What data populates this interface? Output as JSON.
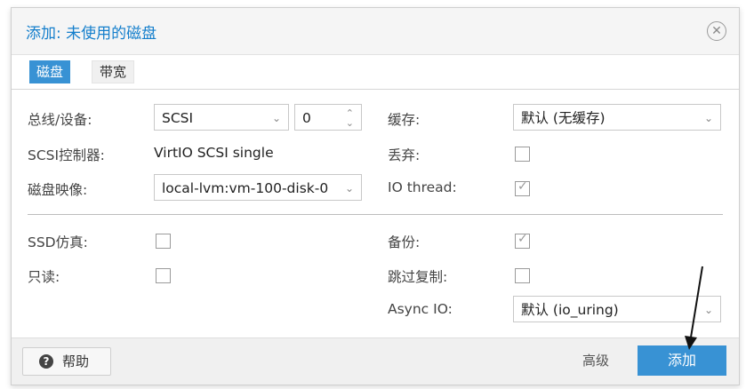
{
  "dialog": {
    "title": "添加: 未使用的磁盘",
    "close_symbol": "✕"
  },
  "tabs": [
    {
      "label": "磁盘",
      "active": true
    },
    {
      "label": "带宽",
      "active": false
    }
  ],
  "form": {
    "bus_device": {
      "label": "总线/设备:",
      "bus_value": "SCSI",
      "index_value": "0"
    },
    "cache": {
      "label": "缓存:",
      "value": "默认 (无缓存)"
    },
    "scsi_controller": {
      "label": "SCSI控制器:",
      "value": "VirtIO SCSI single"
    },
    "discard": {
      "label": "丢弃:",
      "checked": false
    },
    "disk_image": {
      "label": "磁盘映像:",
      "value": "local-lvm:vm-100-disk-0"
    },
    "io_thread": {
      "label": "IO thread:",
      "checked": true
    },
    "ssd_emulation": {
      "label": "SSD仿真:",
      "checked": false
    },
    "backup": {
      "label": "备份:",
      "checked": true
    },
    "read_only": {
      "label": "只读:",
      "checked": false
    },
    "skip_replication": {
      "label": "跳过复制:",
      "checked": false
    },
    "async_io": {
      "label": "Async IO:",
      "value": "默认 (io_uring)"
    }
  },
  "footer": {
    "help_label": "帮助",
    "advanced_label": "高级",
    "add_label": "添加"
  },
  "icons": {
    "help": "question-circle-icon",
    "close": "close-icon",
    "dropdown": "chevron-down-icon",
    "spinner": "spinner-arrows-icon",
    "check": "check-icon"
  },
  "colors": {
    "accent": "#3892d4",
    "title": "#157fcc"
  }
}
